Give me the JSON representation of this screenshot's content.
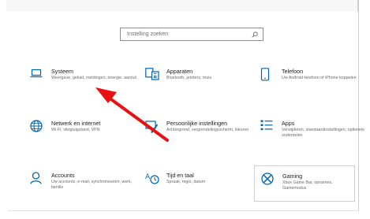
{
  "search": {
    "placeholder": "Instelling zoeken"
  },
  "colors": {
    "accent": "#0063b1",
    "annotation_arrow": "#e81010"
  },
  "tiles": [
    {
      "title": "Systeem",
      "desc": "Weergave, geluid, meldingen, energie, aan/uit",
      "icon": "laptop-icon"
    },
    {
      "title": "Apparaten",
      "desc": "Bluetooth, printers, muis",
      "icon": "devices-icon"
    },
    {
      "title": "Telefoon",
      "desc": "Uw Android-telefoon of iPhone koppelen",
      "icon": "phone-icon"
    },
    {
      "title": "Netwerk en internet",
      "desc": "Wi-Fi, vliegtuigstand, VPN",
      "icon": "globe-icon"
    },
    {
      "title": "Persoonlijke instellingen",
      "desc": "Achtergrond, vergrendelingsscherm, kleuren",
      "icon": "paintbrush-icon"
    },
    {
      "title": "Apps",
      "desc": "Verwijderen, standaardinstellingen, optionele onderdelen",
      "icon": "apps-list-icon"
    },
    {
      "title": "Accounts",
      "desc": "Uw accounts, e-mail, synchroniseren, werk, familie",
      "icon": "person-icon"
    },
    {
      "title": "Tijd en taal",
      "desc": "Spraak, regio, datum",
      "icon": "time-language-icon"
    },
    {
      "title": "Gaming",
      "desc": "Xbox Game Bar, opnames, Gamemodus",
      "icon": "xbox-icon"
    }
  ]
}
